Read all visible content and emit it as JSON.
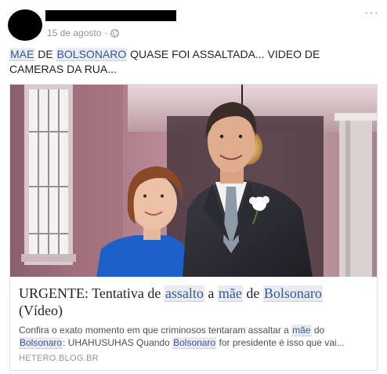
{
  "post": {
    "timestamp": "15 de agosto",
    "separator": "·",
    "menu_label": "···",
    "text_parts": [
      "MAE",
      " DE ",
      "BOLSONARO",
      " QUASE FOI ASSALTADA... VIDEO DE CAMERAS DA RUA..."
    ]
  },
  "link": {
    "title_parts": [
      "URGENTE: Tentativa de ",
      "assalto",
      " a ",
      "mãe",
      " de ",
      "Bolsonaro",
      " (Vídeo)"
    ],
    "desc_parts": [
      "Confira o exato momento em que criminosos tentaram assaltar a ",
      "mãe",
      " do ",
      "Bolsonaro",
      ":   UHAHUSUHAS Quando ",
      "Bolsonaro",
      " for presidente é isso que vai..."
    ],
    "domain": "HETERO.BLOG.BR"
  },
  "icons": {
    "globe": "globe-icon",
    "menu": "more-options-icon"
  },
  "colors": {
    "link_highlight_bg": "#e9ebee",
    "link_highlight_text": "#365899",
    "meta_gray": "#90949c"
  }
}
